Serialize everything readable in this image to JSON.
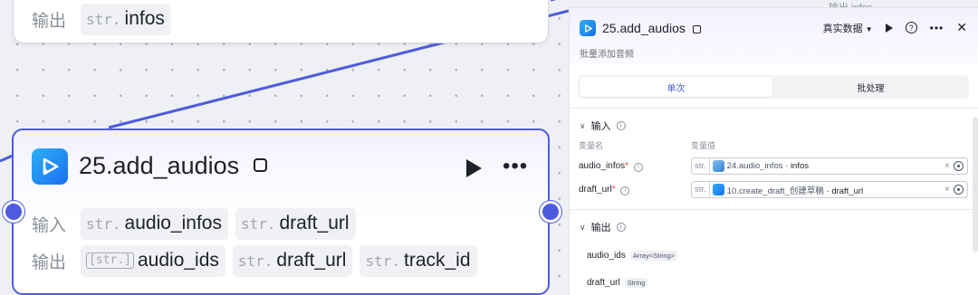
{
  "top_node": {
    "output_label": "输出",
    "outputs": [
      {
        "type": "str.",
        "name": "infos"
      }
    ]
  },
  "main_node": {
    "title": "25.add_audios",
    "input_label": "输入",
    "inputs": [
      {
        "type": "str.",
        "name": "audio_infos"
      },
      {
        "type": "str.",
        "name": "draft_url"
      }
    ],
    "output_label": "输出",
    "outputs": [
      {
        "type": "[str.]",
        "name": "audio_ids"
      },
      {
        "type": "str.",
        "name": "draft_url"
      },
      {
        "type": "str.",
        "name": "track_id"
      }
    ]
  },
  "corner_fragment": {
    "text": "输出  infos"
  },
  "panel": {
    "title": "25.add_audios",
    "subtitle": "批量添加音频",
    "data_mode": "真实数据",
    "tabs": {
      "single": "单次",
      "batch": "批处理"
    },
    "input_section": "输入",
    "col_var_name": "变量名",
    "col_var_value": "变量值",
    "fields": [
      {
        "label": "audio_infos",
        "type": "str.",
        "ref_node": "24.audio_infos",
        "ref_var": "infos"
      },
      {
        "label": "draft_url",
        "type": "str.",
        "ref_node": "10.create_draft_创建草稿",
        "ref_var": "draft_url"
      }
    ],
    "output_section": "输出",
    "outputs": [
      {
        "name": "audio_ids",
        "type": "Array<String>"
      },
      {
        "name": "draft_url",
        "type": "String"
      }
    ]
  },
  "colors": {
    "accent": "#4e5be0",
    "icon_start": "#2db0f5",
    "icon_end": "#1a6ff0"
  }
}
